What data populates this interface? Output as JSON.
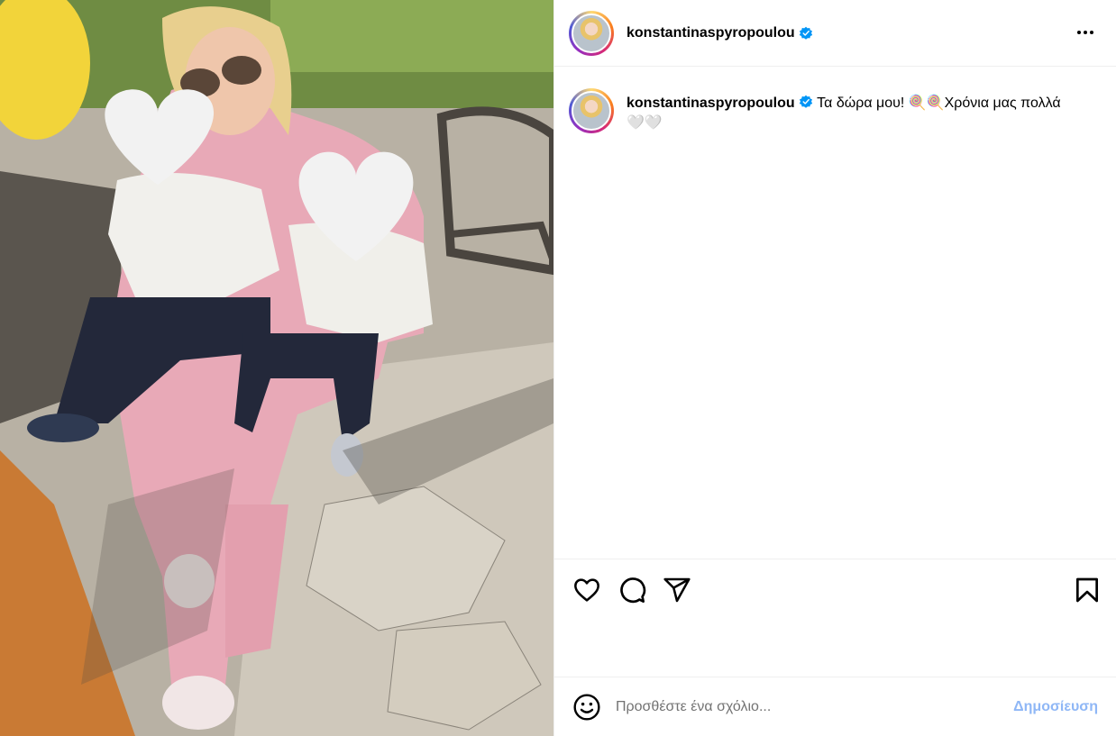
{
  "post": {
    "username": "konstantinaspyropoulou",
    "caption_text": "Τα δώρα μου! 🍭🍭Χρόνια μας πολλά 🤍🤍",
    "photo_alt": "Post photo"
  },
  "comment": {
    "placeholder": "Προσθέστε ένα σχόλιο...",
    "post_label": "Δημοσίευση"
  },
  "icons": {
    "more": "more-options-icon",
    "like": "heart-icon",
    "comment": "comment-icon",
    "share": "share-icon",
    "save": "bookmark-icon",
    "emoji": "emoji-icon",
    "verified": "verified-badge-icon"
  },
  "colors": {
    "verified_blue": "#0095f6",
    "post_button": "#8fb7f6",
    "placeholder": "#737373"
  }
}
